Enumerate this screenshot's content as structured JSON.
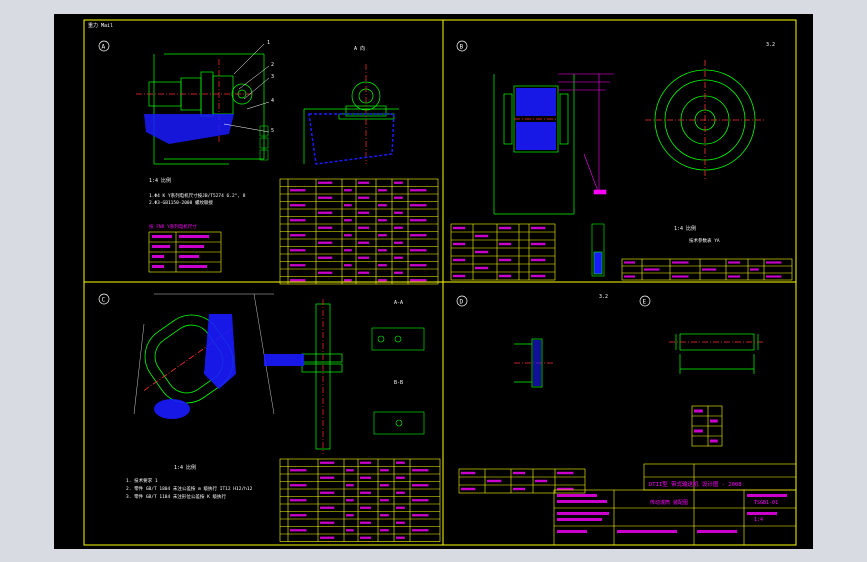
{
  "app": {
    "background": "#d8dbe2",
    "canvas_background": "#000000"
  },
  "colors": {
    "frame": "#ffff00",
    "geometry": "#00ff00",
    "hatch": "#1a1aff",
    "text": "#ffffff",
    "table_text": "#ff00ff",
    "accent": "#ff0000",
    "centerline": "#ff3030"
  },
  "drawing": {
    "title_tag": "重力 Mail",
    "quadrants": {
      "A": {
        "marker": "A",
        "view_label": "A 向",
        "scale_label": "1:4  比例",
        "note_heading": "技 术 要 求",
        "notes": [
          "1.Φ4  K  Y系列电机尺寸按JB/T5274  6.2°, 8",
          "2.Φ3-GB1150-2008  螺纹联接",
          "技  FNR  Y系列电机尺寸"
        ]
      },
      "B": {
        "marker": "B",
        "roughness": "3.2",
        "spec_label": "技术参数表  YA"
      },
      "C": {
        "marker": "C",
        "scale_label": "1:4  比例",
        "notes": [
          "1. 技术要求  1",
          "2. 零件 GB/T 1804 未注公差按 m 级执行  IT12  H12/h12",
          "3. 零件 GB/T 1184 未注形位公差按 K 级执行"
        ],
        "section_labels": [
          "A-A",
          "B-B"
        ]
      },
      "D": {
        "marker": "D",
        "roughness": "3.2"
      },
      "E": {
        "marker": "E"
      }
    },
    "title_block": {
      "title": "DTII型 带式输送机 设计图 - 2008",
      "subtitle": "传动滚筒 装配图",
      "code": "TSGB1-01",
      "scale": "1:4"
    }
  }
}
